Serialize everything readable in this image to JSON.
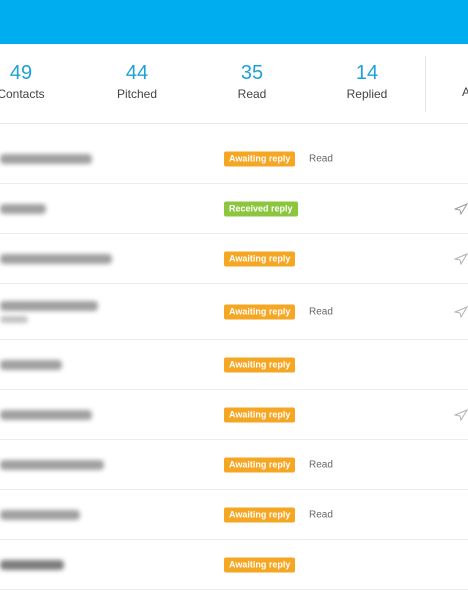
{
  "stats": [
    {
      "value": "49",
      "label": "Contacts"
    },
    {
      "value": "44",
      "label": "Pitched"
    },
    {
      "value": "35",
      "label": "Read"
    },
    {
      "value": "14",
      "label": "Replied"
    }
  ],
  "stats_cut_label": "A",
  "rows": [
    {
      "status": "Awaiting reply",
      "status_type": "awaiting",
      "read": "Read",
      "icon": "none"
    },
    {
      "status": "Received reply",
      "status_type": "received",
      "read": "",
      "icon": "paper-plane-icon"
    },
    {
      "status": "Awaiting reply",
      "status_type": "awaiting",
      "read": "",
      "icon": "paper-plane-icon"
    },
    {
      "status": "Awaiting reply",
      "status_type": "awaiting",
      "read": "Read",
      "icon": "paper-plane-icon"
    },
    {
      "status": "Awaiting reply",
      "status_type": "awaiting",
      "read": "",
      "icon": "none"
    },
    {
      "status": "Awaiting reply",
      "status_type": "awaiting",
      "read": "",
      "icon": "paper-plane-icon"
    },
    {
      "status": "Awaiting reply",
      "status_type": "awaiting",
      "read": "Read",
      "icon": "none"
    },
    {
      "status": "Awaiting reply",
      "status_type": "awaiting",
      "read": "Read",
      "icon": "none"
    },
    {
      "status": "Awaiting reply",
      "status_type": "awaiting",
      "read": "",
      "icon": "none"
    }
  ],
  "colors": {
    "header": "#00aeef",
    "accent": "#1fa1d8",
    "awaiting": "#f5a623",
    "received": "#8cc63f"
  }
}
